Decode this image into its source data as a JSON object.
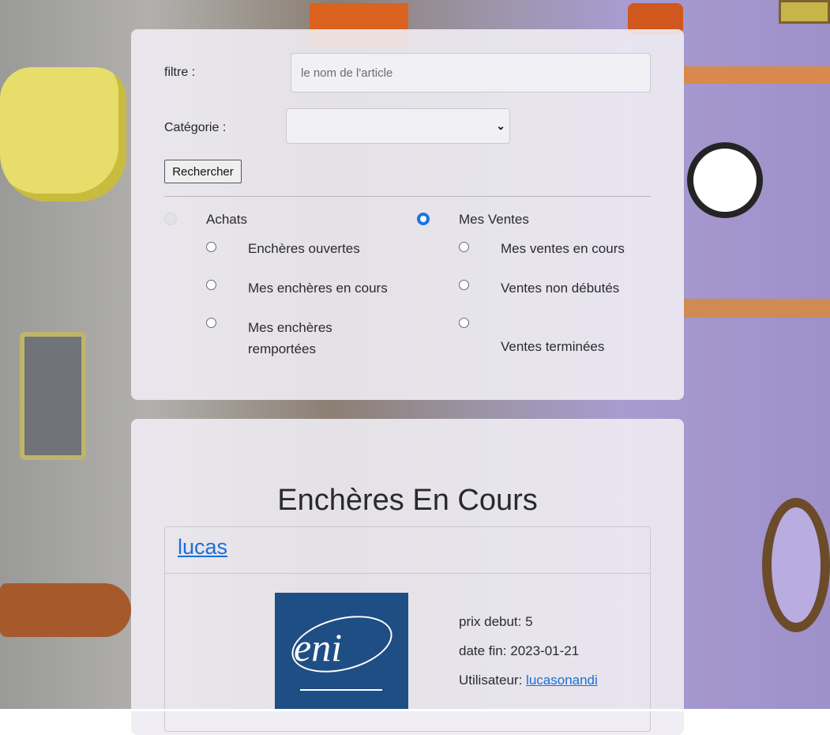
{
  "filters": {
    "filter_label": "filtre :",
    "filter_placeholder": "le nom de l'article",
    "category_label": "Catégorie :",
    "category_selected": "",
    "search_button": "Rechercher"
  },
  "purchases": {
    "label": "Achats",
    "selected": false,
    "options": [
      "Enchères ouvertes",
      "Mes enchères en cours",
      "Mes enchères remportées"
    ]
  },
  "sales": {
    "label": "Mes Ventes",
    "selected": true,
    "options": [
      "Mes ventes en cours",
      "Ventes non débutés",
      "Ventes terminées"
    ]
  },
  "results": {
    "title": "Enchères En Cours",
    "items": [
      {
        "name": "lucas",
        "image_text": "eni",
        "price_label": "prix debut:",
        "price": "5",
        "end_label": "date fin:",
        "end_date": "2023-01-21",
        "user_label": "Utilisateur:",
        "user": "lucasonandi"
      }
    ]
  },
  "colors": {
    "accent": "#1a73e8",
    "link": "#1a6ed8",
    "logo_bg": "#1f4e85"
  }
}
